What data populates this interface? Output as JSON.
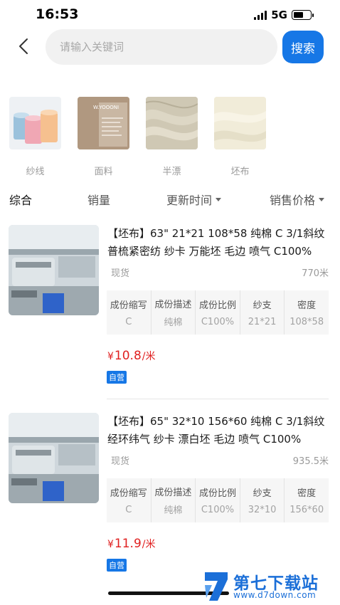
{
  "status": {
    "time": "16:53",
    "network": "5G"
  },
  "search": {
    "placeholder": "请输入关键词",
    "button": "搜索"
  },
  "categories": [
    {
      "label": "纱线",
      "icon": "yarn-icon"
    },
    {
      "label": "面料",
      "icon": "fabric-label-icon",
      "image_text": "W.YOOONI"
    },
    {
      "label": "半漂",
      "icon": "semi-bleached-fabric-icon"
    },
    {
      "label": "坯布",
      "icon": "grey-cloth-icon"
    }
  ],
  "sort": {
    "comprehensive": "综合",
    "sales": "销量",
    "updated": "更新时间",
    "price": "销售价格"
  },
  "products": [
    {
      "title": "【坯布】63\" 21*21 108*58 纯棉 C 3/1斜纹 普梳紧密纺 纱卡 万能坯 毛边 喷气 C100%",
      "stock": "现货",
      "quantity": "770米",
      "spec_headers": [
        "成份缩写",
        "成份描述",
        "成份比例",
        "纱支",
        "密度"
      ],
      "spec_values": [
        "C",
        "纯棉",
        "C100%",
        "21*21",
        "108*58"
      ],
      "currency": "¥",
      "price": "10.8",
      "unit": "/米",
      "badge": "自营"
    },
    {
      "title": "【坯布】65\" 32*10 156*60 纯棉 C 3/1斜纹 经环纬气 纱卡 漂白坯 毛边 喷气 C100%",
      "stock": "现货",
      "quantity": "935.5米",
      "spec_headers": [
        "成份缩写",
        "成份描述",
        "成份比例",
        "纱支",
        "密度"
      ],
      "spec_values": [
        "C",
        "纯棉",
        "C100%",
        "32*10",
        "156*60"
      ],
      "currency": "¥",
      "price": "11.9",
      "unit": "/米",
      "badge": "自营"
    }
  ],
  "watermark": {
    "name": "第七下载站",
    "url": "www.d7down.com"
  },
  "colors": {
    "accent": "#1677e6",
    "price": "#e02020"
  }
}
